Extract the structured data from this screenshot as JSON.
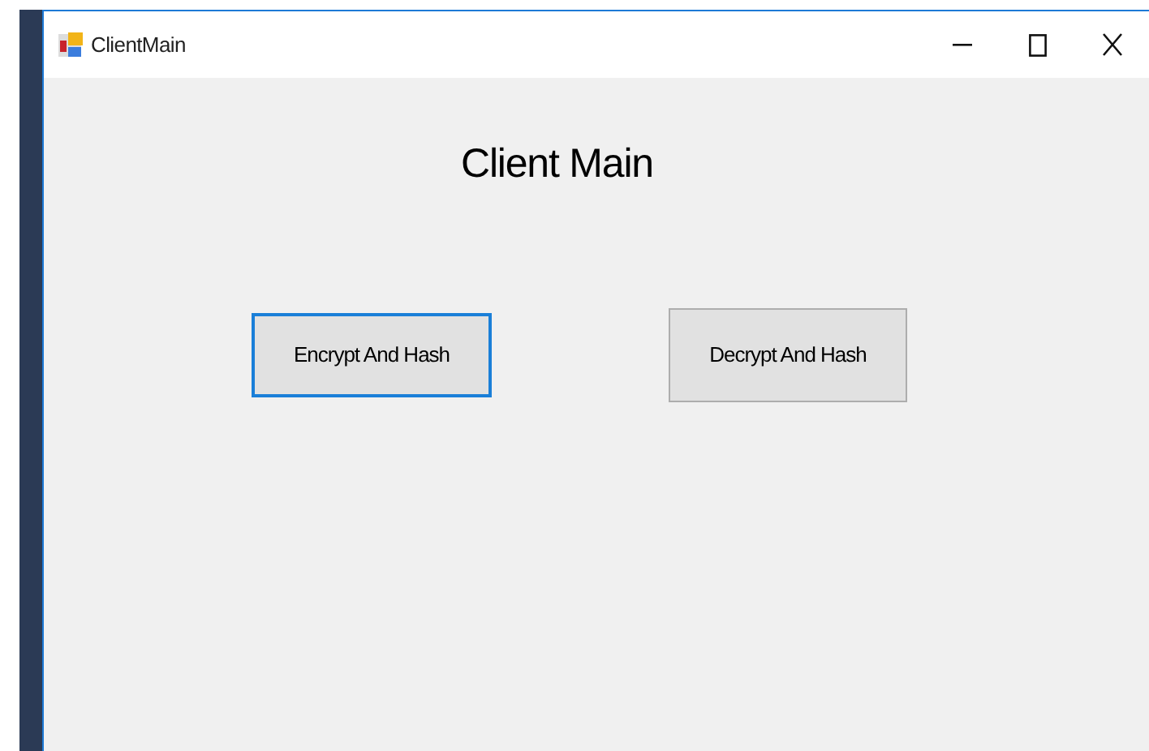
{
  "window": {
    "title": "ClientMain"
  },
  "heading": "Client Main",
  "buttons": [
    {
      "label": "Encrypt And Hash",
      "focused": true
    },
    {
      "label": "Decrypt And Hash",
      "focused": false
    }
  ]
}
